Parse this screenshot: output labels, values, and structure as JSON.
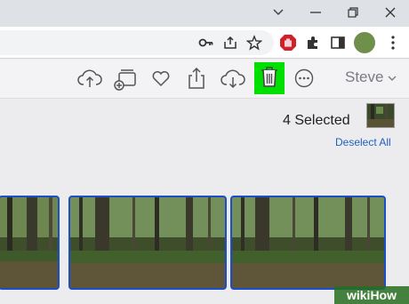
{
  "browser": {
    "window_controls": {
      "minimize": "–",
      "restore": "❐",
      "close": "✕"
    }
  },
  "apptoolbar": {
    "user_label": "Steve",
    "highlight_color": "#00e000"
  },
  "selection": {
    "count_label": "4 Selected",
    "deselect_label": "Deselect All"
  },
  "photos": {
    "count": 3
  },
  "watermark": {
    "text": "wikiHow"
  }
}
